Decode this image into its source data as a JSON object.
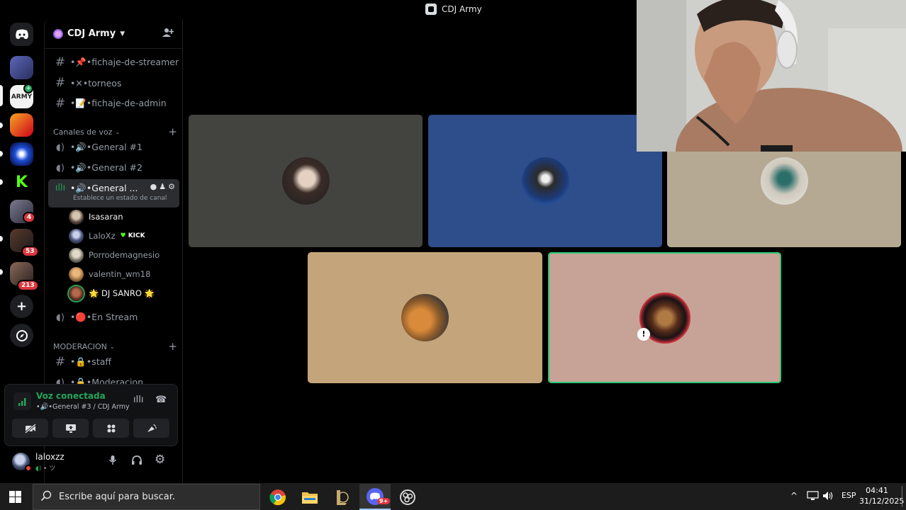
{
  "window": {
    "title": "CDJ Army"
  },
  "rail": {
    "badges": [
      "4",
      "53",
      "213"
    ]
  },
  "server": {
    "name": "CDJ Army"
  },
  "channels": [
    {
      "label": "•📌•fichaje-de-streamer"
    },
    {
      "label": "•✕•torneos"
    },
    {
      "label": "•📝•fichaje-de-admin"
    }
  ],
  "voice_category": {
    "label": "Canales de voz"
  },
  "voice_channels": [
    {
      "label": "•🔊•General #1"
    },
    {
      "label": "•🔊•General #2"
    },
    {
      "label": "•🔊•General ...",
      "status": "Establece un estado de canal"
    }
  ],
  "members": [
    {
      "name": "Isasaran"
    },
    {
      "name": "LaloXz",
      "tag": "KICK"
    },
    {
      "name": "Porrodemagnesio"
    },
    {
      "name": "valentin_wm18"
    },
    {
      "name": "🌟 DJ SANRO 🌟"
    }
  ],
  "stream_channel": {
    "label": "•🔴•En Stream"
  },
  "mod_category": {
    "label": "MODERACION"
  },
  "mod_channels": [
    {
      "label": "•🔒•staff"
    },
    {
      "label": "•🔒•Moderacion"
    }
  ],
  "voice_connected": {
    "title": "Voz conectada",
    "subtitle": "•🔊•General #3 / CDJ Army"
  },
  "user": {
    "name": "laloxzz",
    "status": "• ツ"
  },
  "taskbar": {
    "search_placeholder": "Escribe aquí para buscar.",
    "discord_badge": "9+",
    "lang": "ESP",
    "time": "04:41",
    "date": "31/12/2025"
  },
  "colors": {
    "speaking_green": "#2dc770",
    "tile_1": "#43443f",
    "tile_2": "#2e4d8b",
    "tile_3": "#b5a994",
    "tile_4": "#c4a57b",
    "tile_5": "#c6a396"
  }
}
